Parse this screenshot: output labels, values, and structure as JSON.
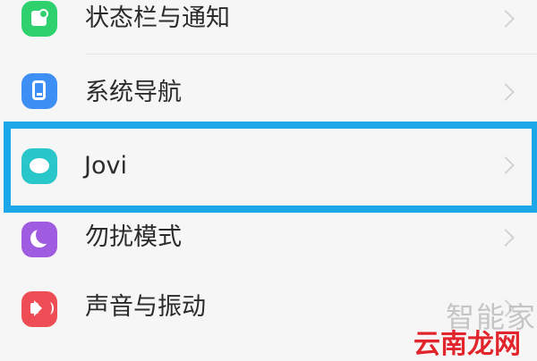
{
  "settings_list": [
    {
      "label": "状态栏与通知",
      "icon": "status-bar-icon",
      "color": "#2ed16e"
    },
    {
      "label": "系统导航",
      "icon": "navigation-icon",
      "color": "#3d8ff5"
    },
    {
      "label": "Jovi",
      "icon": "jovi-icon",
      "color": "#29c7c9",
      "highlighted": true
    },
    {
      "label": "勿扰模式",
      "icon": "moon-icon",
      "color": "#a05ce0"
    },
    {
      "label": "声音与振动",
      "icon": "speaker-icon",
      "color": "#ef4d55"
    }
  ],
  "highlight_color": "#1ba7e8",
  "watermark": {
    "top": "智能家",
    "bottom": "云南龙网"
  }
}
